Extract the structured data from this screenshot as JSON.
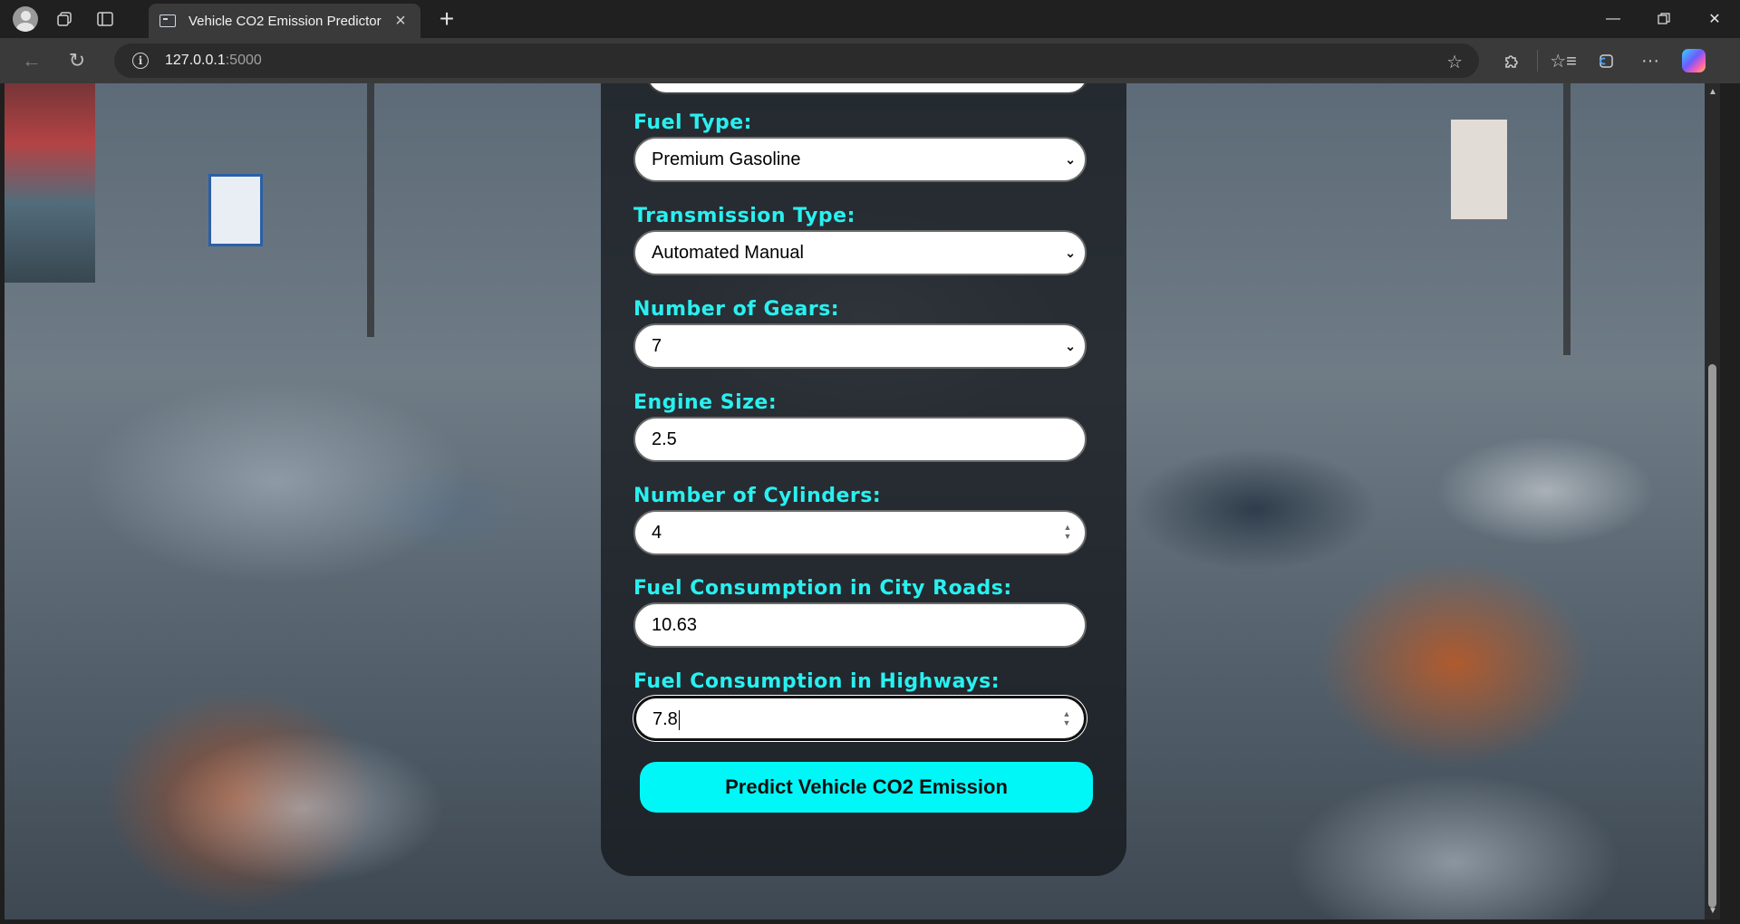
{
  "browser": {
    "tab_title": "Vehicle CO2 Emission Predictor",
    "url_host": "127.0.0.1",
    "url_port": ":5000"
  },
  "form": {
    "fuel_type": {
      "label": "Fuel Type:",
      "value": "Premium Gasoline"
    },
    "transmission_type": {
      "label": "Transmission Type:",
      "value": "Automated Manual"
    },
    "gears": {
      "label": "Number of Gears:",
      "value": "7"
    },
    "engine_size": {
      "label": "Engine Size:",
      "value": "2.5"
    },
    "cylinders": {
      "label": "Number of Cylinders:",
      "value": "4"
    },
    "fuel_city": {
      "label": "Fuel Consumption in City Roads:",
      "value": "10.63"
    },
    "fuel_highway": {
      "label": "Fuel Consumption in Highways:",
      "value": "7.8"
    },
    "submit_label": "Predict Vehicle CO2 Emission"
  },
  "colors": {
    "label_accent": "#29f0f0",
    "button_bg": "#00f7f7",
    "card_bg": "rgba(20,24,28,0.78)"
  },
  "icons": {
    "profile": "avatar-icon",
    "workspaces": "workspaces-icon",
    "tab_actions": "vertical-tabs-icon",
    "back": "back-arrow-icon",
    "reload": "refresh-icon",
    "site_info": "info-icon",
    "favorite": "star-icon",
    "extensions": "puzzle-icon",
    "favorites_bar": "favorites-icon",
    "collections": "collections-icon",
    "more": "more-icon",
    "copilot": "copilot-icon"
  }
}
